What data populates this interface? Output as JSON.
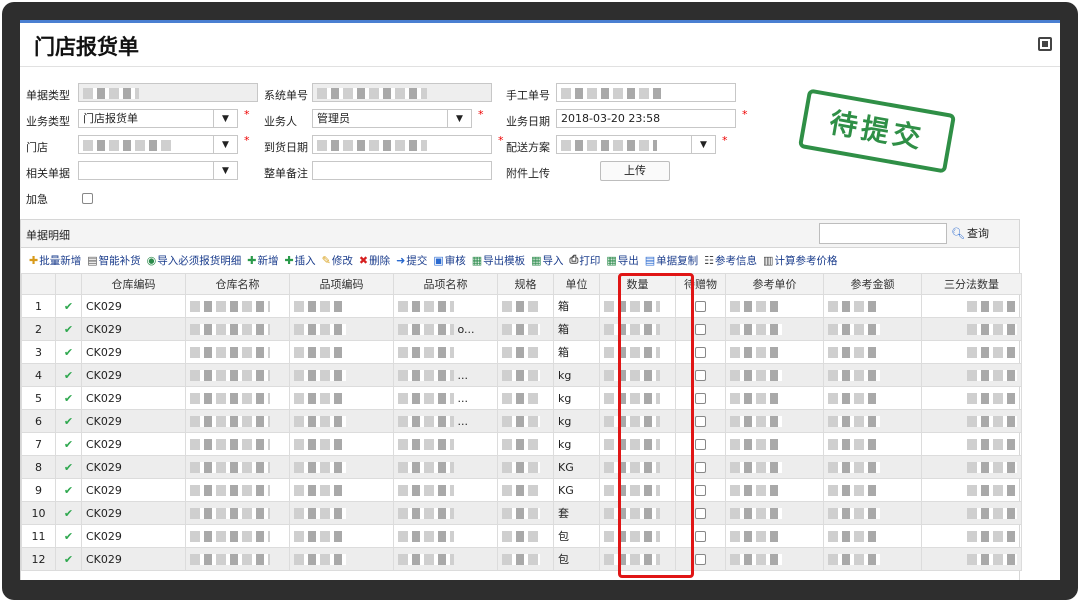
{
  "page": {
    "title": "门店报货单"
  },
  "form": {
    "doc_type_label": "单据类型",
    "doc_type_value": "",
    "sys_no_label": "系统单号",
    "manual_no_label": "手工单号",
    "biz_type_label": "业务类型",
    "biz_type_value": "门店报货单",
    "biz_person_label": "业务人",
    "biz_person_value": "管理员",
    "biz_date_label": "业务日期",
    "biz_date_value": "2018-03-20 23:58",
    "store_label": "门店",
    "arrive_date_label": "到货日期",
    "dispatch_label": "配送方案",
    "related_label": "相关单据",
    "remark_label": "整单备注",
    "attach_label": "附件上传",
    "upload_label": "上传",
    "urgent_label": "加急"
  },
  "stamp": {
    "text": "待提交",
    "color": "#2f8f46"
  },
  "detail": {
    "title": "单据明细",
    "search_label": "查询",
    "toolbar": [
      {
        "icon": "batch-add-icon",
        "glyph": "✚",
        "label": "批量新增",
        "color": "#d89a1a"
      },
      {
        "icon": "smart-fill-icon",
        "glyph": "▤",
        "label": "智能补货",
        "color": "#555555"
      },
      {
        "icon": "import-required-icon",
        "glyph": "◉",
        "label": "导入必须报货明细",
        "color": "#2a8a4a"
      },
      {
        "icon": "add-icon",
        "glyph": "✚",
        "label": "新增",
        "color": "#2a9a4a"
      },
      {
        "icon": "insert-icon",
        "glyph": "✚",
        "label": "插入",
        "color": "#2a9a4a"
      },
      {
        "icon": "edit-icon",
        "glyph": "✎",
        "label": "修改",
        "color": "#d8a01a"
      },
      {
        "icon": "delete-icon",
        "glyph": "✖",
        "label": "删除",
        "color": "#d62020"
      },
      {
        "icon": "submit-icon",
        "glyph": "➜",
        "label": "提交",
        "color": "#2a6ad0"
      },
      {
        "icon": "audit-icon",
        "glyph": "▣",
        "label": "审核",
        "color": "#2a6ad0"
      },
      {
        "icon": "export-template-icon",
        "glyph": "▦",
        "label": "导出模板",
        "color": "#2a8a4a"
      },
      {
        "icon": "import-icon",
        "glyph": "▦",
        "label": "导入",
        "color": "#2a8a4a"
      },
      {
        "icon": "print-icon",
        "glyph": "⎙",
        "label": "打印",
        "color": "#444444"
      },
      {
        "icon": "export-icon",
        "glyph": "▦",
        "label": "导出",
        "color": "#2a8a4a"
      },
      {
        "icon": "copy-icon",
        "glyph": "▤",
        "label": "单据复制",
        "color": "#2a6ad0"
      },
      {
        "icon": "ref-info-icon",
        "glyph": "☷",
        "label": "参考信息",
        "color": "#444444"
      },
      {
        "icon": "calc-price-icon",
        "glyph": "▥",
        "label": "计算参考价格",
        "color": "#444444"
      }
    ],
    "columns": [
      "",
      "",
      "仓库编码",
      "仓库名称",
      "品项编码",
      "品项名称",
      "规格",
      "单位",
      "数量",
      "待赠物",
      "参考单价",
      "参考金额",
      "三分法数量"
    ],
    "rows": [
      {
        "n": "1",
        "code": "CK029",
        "name_tail": "",
        "item_tail": "",
        "unit": "箱"
      },
      {
        "n": "2",
        "code": "CK029",
        "name_tail": "",
        "item_tail": "o...",
        "unit": "箱"
      },
      {
        "n": "3",
        "code": "CK029",
        "name_tail": "",
        "item_tail": "",
        "unit": "箱"
      },
      {
        "n": "4",
        "code": "CK029",
        "name_tail": "",
        "item_tail": "...",
        "unit": "kg"
      },
      {
        "n": "5",
        "code": "CK029",
        "name_tail": "",
        "item_tail": "...",
        "unit": "kg"
      },
      {
        "n": "6",
        "code": "CK029",
        "name_tail": "",
        "item_tail": "...",
        "unit": "kg"
      },
      {
        "n": "7",
        "code": "CK029",
        "name_tail": "",
        "item_tail": "",
        "unit": "kg"
      },
      {
        "n": "8",
        "code": "CK029",
        "name_tail": "",
        "item_tail": "",
        "unit": "KG"
      },
      {
        "n": "9",
        "code": "CK029",
        "name_tail": "",
        "item_tail": "",
        "unit": "KG"
      },
      {
        "n": "10",
        "code": "CK029",
        "name_tail": "",
        "item_tail": "",
        "unit": "套"
      },
      {
        "n": "11",
        "code": "CK029",
        "name_tail": "",
        "item_tail": "",
        "unit": "包"
      },
      {
        "n": "12",
        "code": "CK029",
        "name_tail": "",
        "item_tail": "",
        "unit": "包"
      }
    ]
  },
  "icons": {
    "check": "check-icon",
    "search": "search-icon",
    "dropdown": "chevron-down-icon"
  },
  "colors": {
    "accent": "#4a7fd1",
    "highlight": "#e01515",
    "check": "#2fa84f"
  }
}
